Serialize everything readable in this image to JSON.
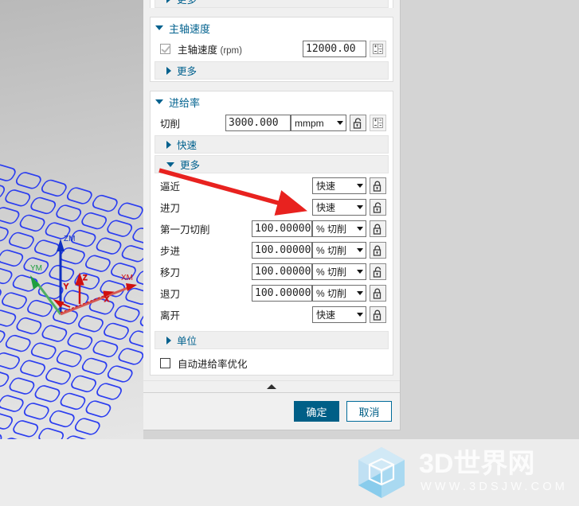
{
  "viewport": {
    "axes": [
      {
        "name": "ZM",
        "color": "#1030c0"
      },
      {
        "name": "YM",
        "color": "#1e9e3e"
      },
      {
        "name": "XM",
        "color": "#d01010"
      },
      {
        "name": "Z",
        "color": "#d01010"
      },
      {
        "name": "Y",
        "color": "#d01010"
      },
      {
        "name": "X",
        "color": "#d01010"
      }
    ]
  },
  "dialog": {
    "top_partial_section": {
      "label": "更多"
    },
    "spindle": {
      "title": "主轴速度",
      "rpm_label": "主轴速度",
      "rpm_unit": "(rpm)",
      "rpm_value": "12000.00",
      "rpm_checked": true,
      "more_label": "更多"
    },
    "feedrate": {
      "title": "进给率",
      "cut_label": "切削",
      "cut_value": "3000.000",
      "cut_unit": "mmpm",
      "rapid_label": "快速",
      "more_label": "更多",
      "unit_label": "单位",
      "auto_opt_label": "自动进给率优化",
      "auto_opt_checked": false,
      "rows": [
        {
          "label": "逼近",
          "value": null,
          "unit": "快速",
          "lock": "closed"
        },
        {
          "label": "进刀",
          "value": null,
          "unit": "快速",
          "lock": "open"
        },
        {
          "label": "第一刀切削",
          "value": "100.00000",
          "unit": "% 切削",
          "lock": "closed"
        },
        {
          "label": "步进",
          "value": "100.00000",
          "unit": "% 切削",
          "lock": "closed"
        },
        {
          "label": "移刀",
          "value": "100.00000",
          "unit": "% 切削",
          "lock": "open"
        },
        {
          "label": "退刀",
          "value": "100.00000",
          "unit": "% 切削",
          "lock": "closed"
        },
        {
          "label": "离开",
          "value": null,
          "unit": "快速",
          "lock": "closed"
        }
      ]
    },
    "footer": {
      "ok_label": "确定",
      "cancel_label": "取消"
    }
  },
  "watermark": {
    "title": "3D世界网",
    "url": "WWW.3DSJW.COM"
  },
  "colors": {
    "accent": "#00618e",
    "primary_button": "#005f87",
    "annotation_arrow": "#e8221f",
    "mesh": "#2b3df0"
  }
}
